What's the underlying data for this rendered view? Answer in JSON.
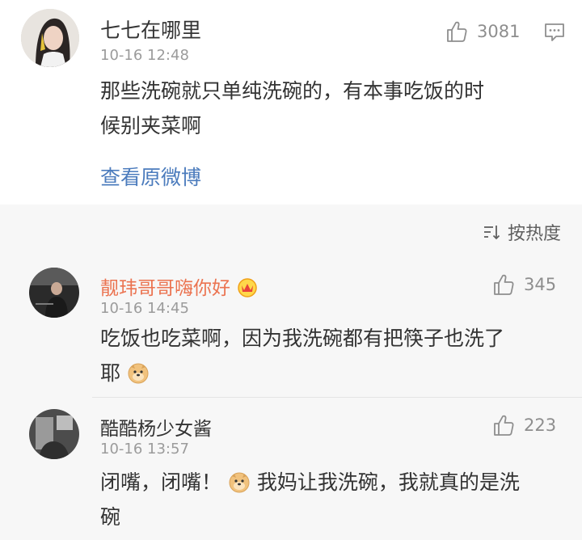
{
  "main_comment": {
    "username": "七七在哪里",
    "timestamp": "10-16 12:48",
    "likes": "3081",
    "text_line1": "那些洗碗就只单纯洗碗的，有本事吃饭的时",
    "text_line2": "候别夹菜啊",
    "view_original": "查看原微博",
    "like_icon": "thumbs-up-icon",
    "reply_icon": "comment-icon"
  },
  "sort": {
    "label": "按热度",
    "icon": "sort-icon"
  },
  "replies": [
    {
      "username": "靓玮哥哥嗨你好",
      "badge_icon": "crown-badge-icon",
      "timestamp": "10-16 14:45",
      "likes": "345",
      "text_line1": "吃饭也吃菜啊，因为我洗碗都有把筷子也洗了",
      "text_line2": "耶",
      "emoji": "doge-emoji-icon"
    },
    {
      "username": "酷酷杨少女酱",
      "timestamp": "10-16 13:57",
      "likes": "223",
      "text_part1": "闭嘴，闭嘴！",
      "emoji": "doge-emoji-icon",
      "text_part2": "我妈让我洗碗，我就真的是洗",
      "text_line2": "碗"
    }
  ],
  "colors": {
    "vip_name": "#eb7350",
    "link": "#4c7cbd",
    "comments_bg": "#f7f7f7",
    "meta_gray": "#9b9b9b"
  }
}
